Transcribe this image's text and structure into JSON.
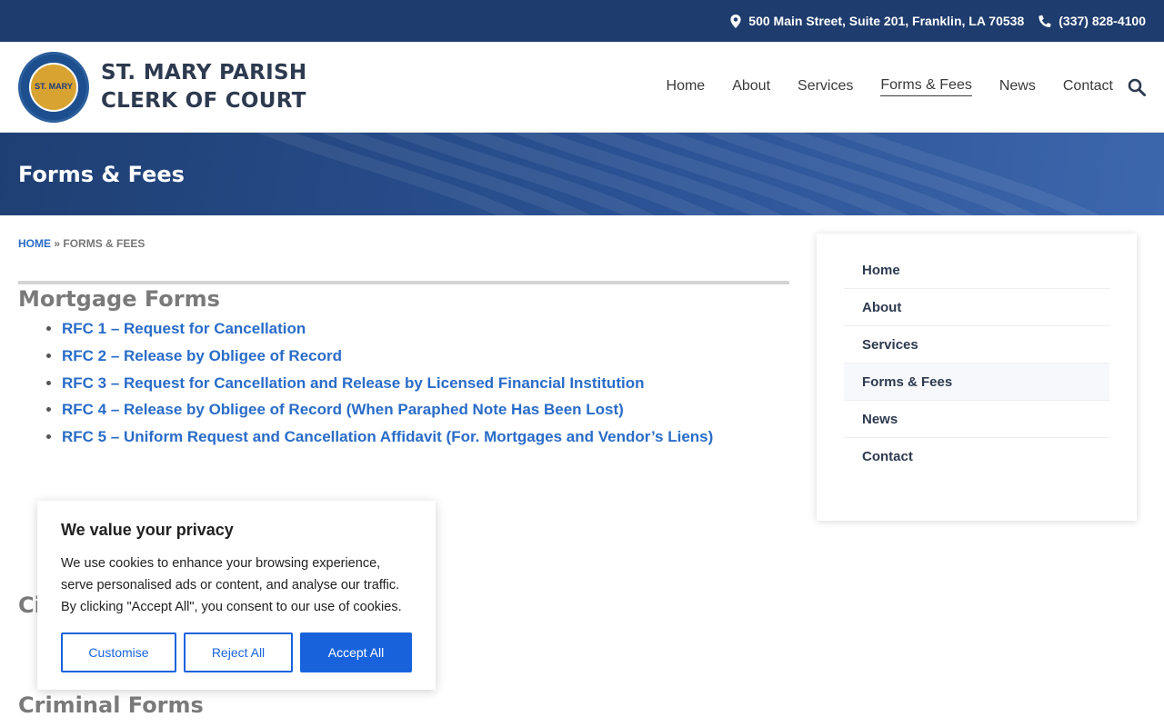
{
  "topbar": {
    "address": "500 Main Street, Suite 201, Franklin, LA 70538",
    "phone": "(337) 828-4100"
  },
  "brand": {
    "line1": "ST. MARY PARISH",
    "line2": "CLERK OF COURT",
    "seal_text": "ST. MARY"
  },
  "nav": {
    "items": [
      "Home",
      "About",
      "Services",
      "Forms & Fees",
      "News",
      "Contact"
    ],
    "active": "Forms & Fees"
  },
  "banner": {
    "title": "Forms & Fees"
  },
  "breadcrumb": {
    "home": "HOME",
    "separator": "»",
    "current": "FORMS & FEES"
  },
  "mortgage": {
    "heading": "Mortgage Forms",
    "items": [
      "RFC 1 – Request for Cancellation",
      "RFC 2 – Release by Obligee of Record",
      "RFC 3 – Request for Cancellation and Release by Licensed Financial Institution",
      "RFC 4 – Release by Obligee of Record (When Paraphed Note Has Been Lost)",
      "RFC 5 – Uniform Request and Cancellation Affidavit (For. Mortgages and Vendor’s Liens)"
    ]
  },
  "partial_heading": "Ci",
  "criminal_heading": "Criminal Forms",
  "sidebar": {
    "items": [
      "Home",
      "About",
      "Services",
      "Forms & Fees",
      "News",
      "Contact"
    ]
  },
  "cookie": {
    "title": "We value your privacy",
    "body": "We use cookies to enhance your browsing experience, serve personalised ads or content, and analyse our traffic. By clicking \"Accept All\", you consent to our use of cookies.",
    "customise": "Customise",
    "reject": "Reject All",
    "accept": "Accept All"
  },
  "colors": {
    "topbar": "#1f3c6e",
    "link": "#2a6cc8",
    "accent_button": "#1863dc"
  }
}
